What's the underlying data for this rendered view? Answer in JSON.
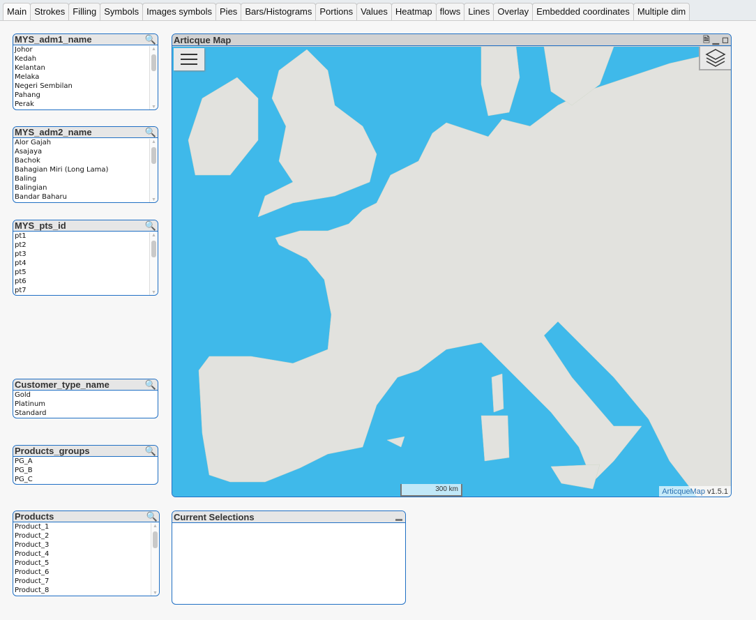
{
  "tabs": [
    "Main",
    "Strokes",
    "Filling",
    "Symbols",
    "Images symbols",
    "Pies",
    "Bars/Histograms",
    "Portions",
    "Values",
    "Heatmap",
    "flows",
    "Lines",
    "Overlay",
    "Embedded coordinates",
    "Multiple dim"
  ],
  "listboxes": [
    {
      "title": "MYS_adm1_name",
      "items": [
        "Johor",
        "Kedah",
        "Kelantan",
        "Melaka",
        "Negeri Sembilan",
        "Pahang",
        "Perak"
      ],
      "scroll": true
    },
    {
      "title": "MYS_adm2_name",
      "items": [
        "Alor Gajah",
        "Asajaya",
        "Bachok",
        "Bahagian Miri (Long Lama)",
        "Baling",
        "Balingian",
        "Bandar Baharu"
      ],
      "scroll": true
    },
    {
      "title": "MYS_pts_id",
      "items": [
        "pt1",
        "pt2",
        "pt3",
        "pt4",
        "pt5",
        "pt6",
        "pt7"
      ],
      "scroll": true
    },
    {
      "title": "Customer_type_name",
      "items": [
        "Gold",
        "Platinum",
        "Standard"
      ],
      "scroll": false
    },
    {
      "title": "Products_groups",
      "items": [
        "PG_A",
        "PG_B",
        "PG_C"
      ],
      "scroll": false
    },
    {
      "title": "Products",
      "items": [
        "Product_1",
        "Product_2",
        "Product_3",
        "Product_4",
        "Product_5",
        "Product_6",
        "Product_7",
        "Product_8"
      ],
      "scroll": true
    }
  ],
  "map": {
    "title": "Articque Map",
    "scale_label": "300 km",
    "attribution_brand": "ArticqueMap",
    "attribution_version": "v1.5.1",
    "colors": {
      "sea": "#3fb9ea",
      "land": "#e2e2de"
    }
  },
  "current_selections": {
    "title": "Current Selections"
  }
}
